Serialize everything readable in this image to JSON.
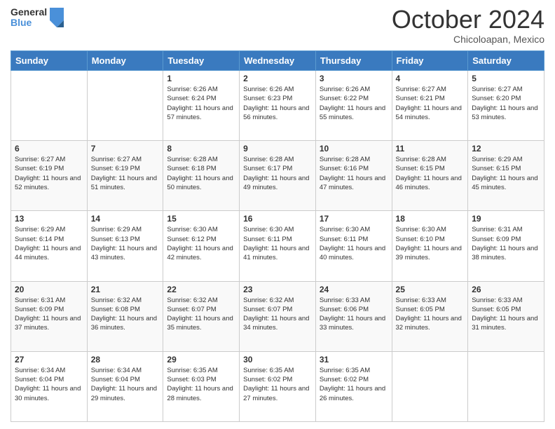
{
  "header": {
    "logo_general": "General",
    "logo_blue": "Blue",
    "month_title": "October 2024",
    "location": "Chicoloapan, Mexico"
  },
  "days_of_week": [
    "Sunday",
    "Monday",
    "Tuesday",
    "Wednesday",
    "Thursday",
    "Friday",
    "Saturday"
  ],
  "weeks": [
    [
      {
        "day": "",
        "sunrise": "",
        "sunset": "",
        "daylight": ""
      },
      {
        "day": "",
        "sunrise": "",
        "sunset": "",
        "daylight": ""
      },
      {
        "day": "1",
        "sunrise": "Sunrise: 6:26 AM",
        "sunset": "Sunset: 6:24 PM",
        "daylight": "Daylight: 11 hours and 57 minutes."
      },
      {
        "day": "2",
        "sunrise": "Sunrise: 6:26 AM",
        "sunset": "Sunset: 6:23 PM",
        "daylight": "Daylight: 11 hours and 56 minutes."
      },
      {
        "day": "3",
        "sunrise": "Sunrise: 6:26 AM",
        "sunset": "Sunset: 6:22 PM",
        "daylight": "Daylight: 11 hours and 55 minutes."
      },
      {
        "day": "4",
        "sunrise": "Sunrise: 6:27 AM",
        "sunset": "Sunset: 6:21 PM",
        "daylight": "Daylight: 11 hours and 54 minutes."
      },
      {
        "day": "5",
        "sunrise": "Sunrise: 6:27 AM",
        "sunset": "Sunset: 6:20 PM",
        "daylight": "Daylight: 11 hours and 53 minutes."
      }
    ],
    [
      {
        "day": "6",
        "sunrise": "Sunrise: 6:27 AM",
        "sunset": "Sunset: 6:19 PM",
        "daylight": "Daylight: 11 hours and 52 minutes."
      },
      {
        "day": "7",
        "sunrise": "Sunrise: 6:27 AM",
        "sunset": "Sunset: 6:19 PM",
        "daylight": "Daylight: 11 hours and 51 minutes."
      },
      {
        "day": "8",
        "sunrise": "Sunrise: 6:28 AM",
        "sunset": "Sunset: 6:18 PM",
        "daylight": "Daylight: 11 hours and 50 minutes."
      },
      {
        "day": "9",
        "sunrise": "Sunrise: 6:28 AM",
        "sunset": "Sunset: 6:17 PM",
        "daylight": "Daylight: 11 hours and 49 minutes."
      },
      {
        "day": "10",
        "sunrise": "Sunrise: 6:28 AM",
        "sunset": "Sunset: 6:16 PM",
        "daylight": "Daylight: 11 hours and 47 minutes."
      },
      {
        "day": "11",
        "sunrise": "Sunrise: 6:28 AM",
        "sunset": "Sunset: 6:15 PM",
        "daylight": "Daylight: 11 hours and 46 minutes."
      },
      {
        "day": "12",
        "sunrise": "Sunrise: 6:29 AM",
        "sunset": "Sunset: 6:15 PM",
        "daylight": "Daylight: 11 hours and 45 minutes."
      }
    ],
    [
      {
        "day": "13",
        "sunrise": "Sunrise: 6:29 AM",
        "sunset": "Sunset: 6:14 PM",
        "daylight": "Daylight: 11 hours and 44 minutes."
      },
      {
        "day": "14",
        "sunrise": "Sunrise: 6:29 AM",
        "sunset": "Sunset: 6:13 PM",
        "daylight": "Daylight: 11 hours and 43 minutes."
      },
      {
        "day": "15",
        "sunrise": "Sunrise: 6:30 AM",
        "sunset": "Sunset: 6:12 PM",
        "daylight": "Daylight: 11 hours and 42 minutes."
      },
      {
        "day": "16",
        "sunrise": "Sunrise: 6:30 AM",
        "sunset": "Sunset: 6:11 PM",
        "daylight": "Daylight: 11 hours and 41 minutes."
      },
      {
        "day": "17",
        "sunrise": "Sunrise: 6:30 AM",
        "sunset": "Sunset: 6:11 PM",
        "daylight": "Daylight: 11 hours and 40 minutes."
      },
      {
        "day": "18",
        "sunrise": "Sunrise: 6:30 AM",
        "sunset": "Sunset: 6:10 PM",
        "daylight": "Daylight: 11 hours and 39 minutes."
      },
      {
        "day": "19",
        "sunrise": "Sunrise: 6:31 AM",
        "sunset": "Sunset: 6:09 PM",
        "daylight": "Daylight: 11 hours and 38 minutes."
      }
    ],
    [
      {
        "day": "20",
        "sunrise": "Sunrise: 6:31 AM",
        "sunset": "Sunset: 6:09 PM",
        "daylight": "Daylight: 11 hours and 37 minutes."
      },
      {
        "day": "21",
        "sunrise": "Sunrise: 6:32 AM",
        "sunset": "Sunset: 6:08 PM",
        "daylight": "Daylight: 11 hours and 36 minutes."
      },
      {
        "day": "22",
        "sunrise": "Sunrise: 6:32 AM",
        "sunset": "Sunset: 6:07 PM",
        "daylight": "Daylight: 11 hours and 35 minutes."
      },
      {
        "day": "23",
        "sunrise": "Sunrise: 6:32 AM",
        "sunset": "Sunset: 6:07 PM",
        "daylight": "Daylight: 11 hours and 34 minutes."
      },
      {
        "day": "24",
        "sunrise": "Sunrise: 6:33 AM",
        "sunset": "Sunset: 6:06 PM",
        "daylight": "Daylight: 11 hours and 33 minutes."
      },
      {
        "day": "25",
        "sunrise": "Sunrise: 6:33 AM",
        "sunset": "Sunset: 6:05 PM",
        "daylight": "Daylight: 11 hours and 32 minutes."
      },
      {
        "day": "26",
        "sunrise": "Sunrise: 6:33 AM",
        "sunset": "Sunset: 6:05 PM",
        "daylight": "Daylight: 11 hours and 31 minutes."
      }
    ],
    [
      {
        "day": "27",
        "sunrise": "Sunrise: 6:34 AM",
        "sunset": "Sunset: 6:04 PM",
        "daylight": "Daylight: 11 hours and 30 minutes."
      },
      {
        "day": "28",
        "sunrise": "Sunrise: 6:34 AM",
        "sunset": "Sunset: 6:04 PM",
        "daylight": "Daylight: 11 hours and 29 minutes."
      },
      {
        "day": "29",
        "sunrise": "Sunrise: 6:35 AM",
        "sunset": "Sunset: 6:03 PM",
        "daylight": "Daylight: 11 hours and 28 minutes."
      },
      {
        "day": "30",
        "sunrise": "Sunrise: 6:35 AM",
        "sunset": "Sunset: 6:02 PM",
        "daylight": "Daylight: 11 hours and 27 minutes."
      },
      {
        "day": "31",
        "sunrise": "Sunrise: 6:35 AM",
        "sunset": "Sunset: 6:02 PM",
        "daylight": "Daylight: 11 hours and 26 minutes."
      },
      {
        "day": "",
        "sunrise": "",
        "sunset": "",
        "daylight": ""
      },
      {
        "day": "",
        "sunrise": "",
        "sunset": "",
        "daylight": ""
      }
    ]
  ]
}
